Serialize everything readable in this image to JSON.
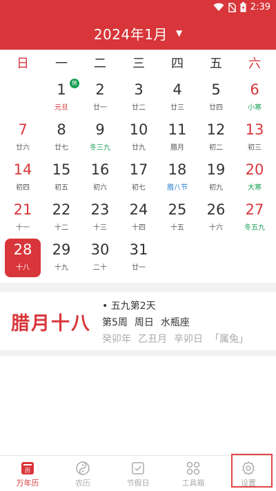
{
  "status_bar": {
    "time": "2:39"
  },
  "header": {
    "title": "2024年1月",
    "dropdown_icon": "caret-down-icon"
  },
  "weekdays": [
    "日",
    "一",
    "二",
    "三",
    "四",
    "五",
    "六"
  ],
  "days": [
    {
      "num": "1",
      "sub": "元旦",
      "sub_color": "red",
      "badge": "休"
    },
    {
      "num": "2",
      "sub": "廿一"
    },
    {
      "num": "3",
      "sub": "廿二"
    },
    {
      "num": "4",
      "sub": "廿三"
    },
    {
      "num": "5",
      "sub": "廿四"
    },
    {
      "num": "6",
      "sub": "小寒",
      "sub_color": "green"
    },
    {
      "num": "7",
      "sub": "廿六"
    },
    {
      "num": "8",
      "sub": "廿七"
    },
    {
      "num": "9",
      "sub": "冬三九",
      "sub_color": "green"
    },
    {
      "num": "10",
      "sub": "廿九"
    },
    {
      "num": "11",
      "sub": "腊月"
    },
    {
      "num": "12",
      "sub": "初二"
    },
    {
      "num": "13",
      "sub": "初三"
    },
    {
      "num": "14",
      "sub": "初四"
    },
    {
      "num": "15",
      "sub": "初五"
    },
    {
      "num": "16",
      "sub": "初六"
    },
    {
      "num": "17",
      "sub": "初七"
    },
    {
      "num": "18",
      "sub": "腊八节",
      "sub_color": "blue"
    },
    {
      "num": "19",
      "sub": "初九"
    },
    {
      "num": "20",
      "sub": "大寒",
      "sub_color": "green"
    },
    {
      "num": "21",
      "sub": "十一"
    },
    {
      "num": "22",
      "sub": "十二"
    },
    {
      "num": "23",
      "sub": "十三"
    },
    {
      "num": "24",
      "sub": "十四"
    },
    {
      "num": "25",
      "sub": "十五"
    },
    {
      "num": "26",
      "sub": "十六"
    },
    {
      "num": "27",
      "sub": "冬五九",
      "sub_color": "green"
    },
    {
      "num": "28",
      "sub": "十八",
      "today": true
    },
    {
      "num": "29",
      "sub": "十九"
    },
    {
      "num": "30",
      "sub": "二十"
    },
    {
      "num": "31",
      "sub": "廿一"
    }
  ],
  "first_weekday": 1,
  "info": {
    "lunar_date": "腊月十八",
    "line1": "• 五九第2天",
    "week": "第5周",
    "weekday": "周日",
    "zodiac_sign": "水瓶座",
    "ganzhi_year": "癸卯年",
    "ganzhi_month": "乙丑月",
    "ganzhi_day": "辛卯日",
    "animal": "「属兔」"
  },
  "tabs": [
    {
      "label": "万年历",
      "icon": "calendar-icon",
      "active": true
    },
    {
      "label": "农历",
      "icon": "yin-yang-icon"
    },
    {
      "label": "节假日",
      "icon": "holiday-check-icon"
    },
    {
      "label": "工具箱",
      "icon": "toolbox-grid-icon"
    },
    {
      "label": "设置",
      "icon": "gear-icon"
    }
  ],
  "colors": {
    "accent": "#d8363a",
    "green": "#1a9e55",
    "blue": "#2c7fd1"
  }
}
